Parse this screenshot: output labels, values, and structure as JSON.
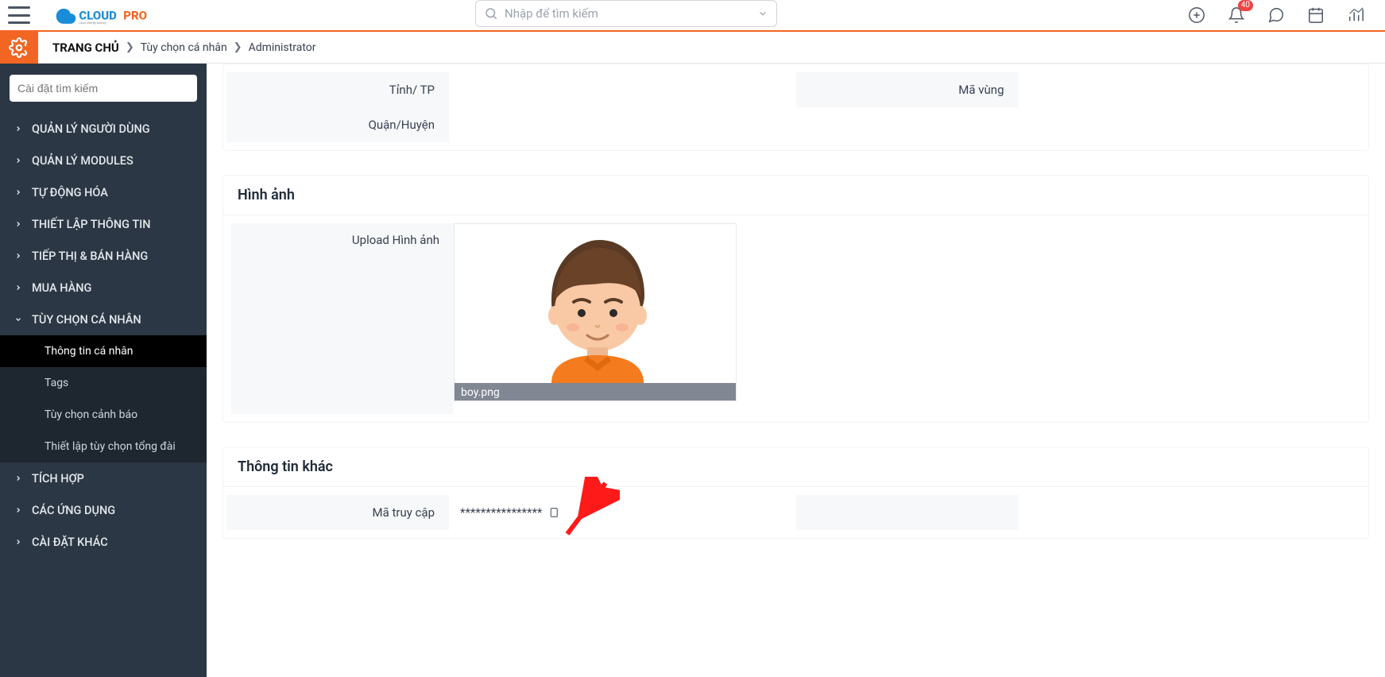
{
  "header": {
    "search_placeholder": "Nhập để tìm kiếm",
    "notif_badge": "40"
  },
  "breadcrumb": {
    "home": "TRANG CHỦ",
    "c1": "Tùy chọn cá nhân",
    "c2": "Administrator"
  },
  "sidebar": {
    "search_placeholder": "Cài đặt tìm kiếm",
    "items": {
      "user_mgmt": "QUẢN LÝ NGƯỜI DÙNG",
      "modules": "QUẢN LÝ MODULES",
      "automation": "TỰ ĐỘNG HÓA",
      "config": "THIẾT LẬP THÔNG TIN",
      "marketing": "TIẾP THỊ & BÁN HÀNG",
      "purchase": "MUA HÀNG",
      "personal": "TÙY CHỌN CÁ NHÂN",
      "integration": "TÍCH HỢP",
      "apps": "CÁC ỨNG DỤNG",
      "other": "CÀI ĐẶT KHÁC"
    },
    "personal_sub": {
      "profile": "Thông tin cá nhân",
      "tags": "Tags",
      "alerts": "Tùy chọn cảnh báo",
      "callcenter": "Thiết lập tùy chọn tổng đài"
    }
  },
  "fields": {
    "province": "Tỉnh/ TP",
    "district": "Quận/Huyện",
    "region_code": "Mã vùng"
  },
  "image_section": {
    "title": "Hình ảnh",
    "upload_label": "Upload Hình ảnh",
    "filename": "boy.png"
  },
  "other_section": {
    "title": "Thông tin khác",
    "access_code_label": "Mã truy cập",
    "access_code_value": "****************"
  }
}
